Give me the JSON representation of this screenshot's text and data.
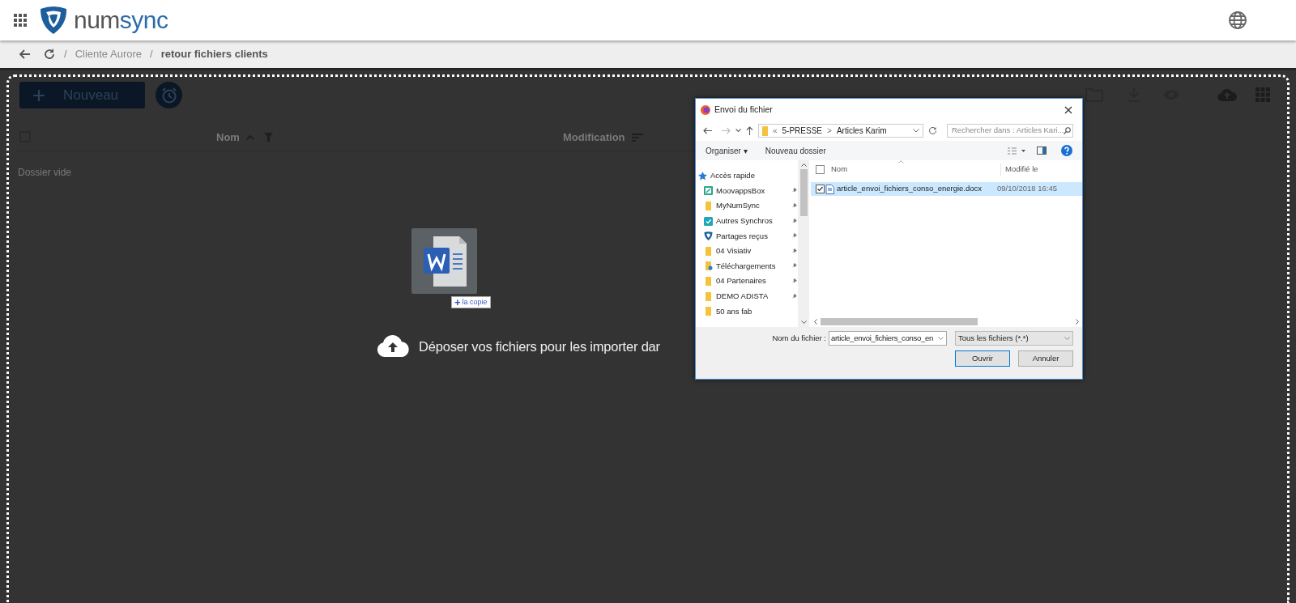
{
  "header": {
    "logo": {
      "part_1": "num",
      "part_2": "sync"
    }
  },
  "breadcrumb": [
    {
      "separator": "/",
      "label": "Cliente Aurore",
      "current": false
    },
    {
      "separator": "/",
      "label": "retour fichiers clients",
      "current": true
    }
  ],
  "toolbar": {
    "new_button": "Nouveau"
  },
  "table": {
    "select_all": {
      "checked": false
    },
    "columns": [
      {
        "label": "Nom",
        "kind": "name"
      },
      {
        "label": "Modification",
        "kind": "date"
      }
    ],
    "empty_text": "Dossier vide"
  },
  "drag": {
    "badge_sign": "+",
    "badge_text": "la copie"
  },
  "drop_text": "Déposer vos fichiers pour les importer dar",
  "dialog": {
    "title": "Envoi du fichier",
    "path": [
      "«",
      "5-PRESSE",
      ">",
      "Articles Karim"
    ],
    "search_placeholder": "Rechercher dans : Articles Kari...",
    "commands": [
      "Organiser ▾",
      "Nouveau dossier"
    ],
    "nav_items": [
      {
        "label": "Accès rapide",
        "kind": "star",
        "pinned": false
      },
      {
        "label": "MoovappsBox",
        "kind": "app",
        "pinned": true
      },
      {
        "label": "MyNumSync",
        "kind": "folder",
        "pinned": true
      },
      {
        "label": "Autres Synchros",
        "kind": "sync",
        "pinned": true
      },
      {
        "label": "Partages reçus",
        "kind": "shield",
        "pinned": true
      },
      {
        "label": "04 Visiativ",
        "kind": "folder",
        "pinned": true
      },
      {
        "label": "Téléchargements",
        "kind": "downloads",
        "pinned": true
      },
      {
        "label": "04 Partenaires",
        "kind": "folder",
        "pinned": true
      },
      {
        "label": "DEMO ADISTA",
        "kind": "folder",
        "pinned": true
      },
      {
        "label": "50 ans fab",
        "kind": "folder",
        "pinned": false
      }
    ],
    "columns": [
      "Nom",
      "Modifié le"
    ],
    "select_all_checked": false,
    "files": [
      {
        "name": "article_envoi_fichiers_conso_energie.docx",
        "modified": "09/10/2018 16:45",
        "selected": true,
        "checked": true
      }
    ],
    "filename_label": "Nom du fichier :",
    "filename_value": "article_envoi_fichiers_conso_en",
    "filter": "Tous les fichiers (*.*)",
    "buttons": [
      {
        "label": "Ouvrir",
        "default": true
      },
      {
        "label": "Annuler",
        "default": false
      }
    ]
  }
}
